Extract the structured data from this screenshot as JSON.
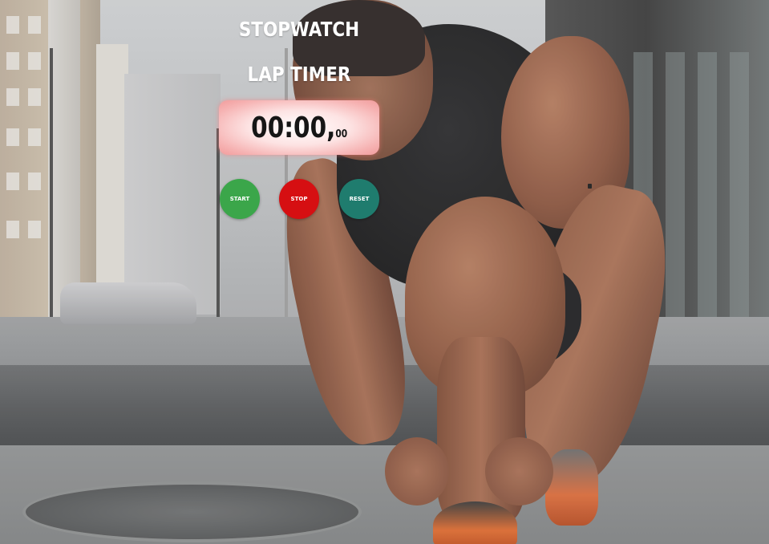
{
  "app": {
    "title": "STOPWATCH",
    "subtitle": "LAP TIMER"
  },
  "display": {
    "time_main": "00:00,",
    "time_ms": "00"
  },
  "controls": {
    "start_label": "START",
    "stop_label": "STOP",
    "reset_label": "RESET"
  },
  "colors": {
    "start": "#3ba64a",
    "stop": "#d60f12",
    "reset": "#1f7c6e",
    "display_glow": "#f19c9c",
    "title_text": "#ffffff"
  }
}
